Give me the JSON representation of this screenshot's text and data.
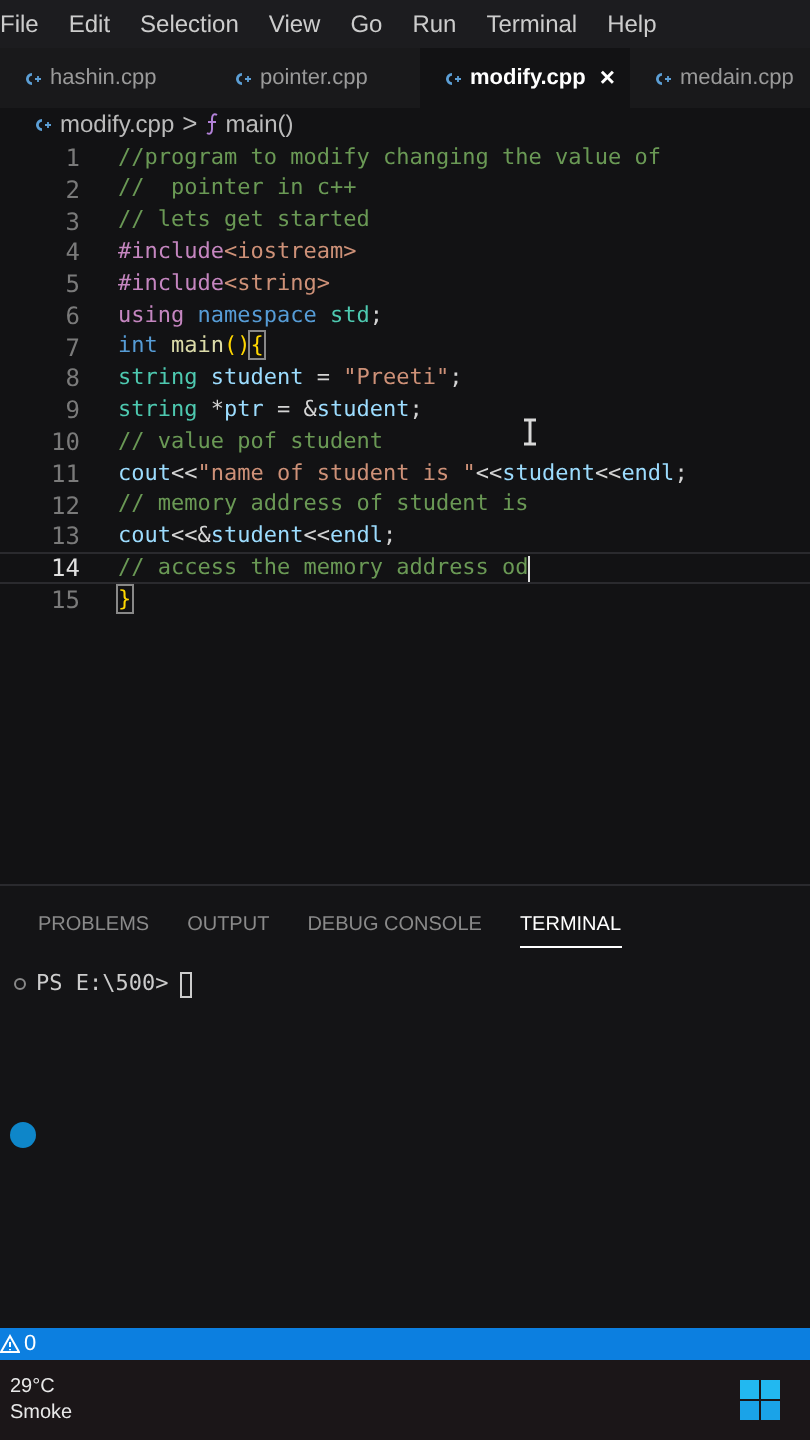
{
  "menu": [
    "File",
    "Edit",
    "Selection",
    "View",
    "Go",
    "Run",
    "Terminal",
    "Help"
  ],
  "tabs": [
    {
      "label": "hashin.cpp",
      "selected": false
    },
    {
      "label": "pointer.cpp",
      "selected": false
    },
    {
      "label": "modify.cpp",
      "selected": true,
      "close": "×"
    },
    {
      "label": "medain.cpp",
      "selected": false
    }
  ],
  "breadcrumb": {
    "file": "modify.cpp",
    "separator": ">",
    "symbol": "main()"
  },
  "code_lines": [
    {
      "number": "1",
      "current": false,
      "tokens": [
        {
          "kind": "comment",
          "text": "//program to modify changing the value of"
        }
      ]
    },
    {
      "number": "2",
      "current": false,
      "tokens": [
        {
          "kind": "comment",
          "text": "//  pointer in c++"
        }
      ]
    },
    {
      "number": "3",
      "current": false,
      "tokens": [
        {
          "kind": "comment",
          "text": "// lets get started"
        }
      ]
    },
    {
      "number": "4",
      "current": false,
      "tokens": [
        {
          "kind": "directive",
          "text": "#include"
        },
        {
          "kind": "header",
          "text": "<iostream>"
        }
      ]
    },
    {
      "number": "5",
      "current": false,
      "tokens": [
        {
          "kind": "directive",
          "text": "#include"
        },
        {
          "kind": "header",
          "text": "<string>"
        }
      ]
    },
    {
      "number": "6",
      "current": false,
      "tokens": [
        {
          "kind": "control",
          "text": "using"
        },
        {
          "kind": "storage",
          "text": " namespace"
        },
        {
          "kind": "type",
          "text": " std"
        },
        {
          "kind": "plain",
          "text": ";"
        }
      ]
    },
    {
      "number": "7",
      "current": false,
      "tokens": [
        {
          "kind": "storage",
          "text": "int"
        },
        {
          "kind": "function",
          "text": " main"
        },
        {
          "kind": "paren",
          "text": "()"
        },
        {
          "kind": "bracket_match",
          "text": "{"
        }
      ]
    },
    {
      "number": "8",
      "current": false,
      "tokens": [
        {
          "kind": "type",
          "text": "string"
        },
        {
          "kind": "variable",
          "text": " student"
        },
        {
          "kind": "plain",
          "text": " = "
        },
        {
          "kind": "string",
          "text": "\"Preeti\""
        },
        {
          "kind": "plain",
          "text": ";"
        }
      ]
    },
    {
      "number": "9",
      "current": false,
      "tokens": [
        {
          "kind": "type",
          "text": "string"
        },
        {
          "kind": "plain",
          "text": " *"
        },
        {
          "kind": "variable",
          "text": "ptr"
        },
        {
          "kind": "plain",
          "text": " = &"
        },
        {
          "kind": "variable",
          "text": "student"
        },
        {
          "kind": "plain",
          "text": ";"
        }
      ]
    },
    {
      "number": "10",
      "current": false,
      "tokens": [
        {
          "kind": "comment",
          "text": "// value pof student"
        }
      ]
    },
    {
      "number": "11",
      "current": false,
      "tokens": [
        {
          "kind": "variable",
          "text": "cout"
        },
        {
          "kind": "plain",
          "text": "<<"
        },
        {
          "kind": "string",
          "text": "\"name of student is \""
        },
        {
          "kind": "plain",
          "text": "<<"
        },
        {
          "kind": "variable",
          "text": "student"
        },
        {
          "kind": "plain",
          "text": "<<"
        },
        {
          "kind": "variable",
          "text": "endl"
        },
        {
          "kind": "plain",
          "text": ";"
        }
      ]
    },
    {
      "number": "12",
      "current": false,
      "tokens": [
        {
          "kind": "comment",
          "text": "// memory address of student is"
        }
      ]
    },
    {
      "number": "13",
      "current": false,
      "tokens": [
        {
          "kind": "variable",
          "text": "cout"
        },
        {
          "kind": "plain",
          "text": "<<&"
        },
        {
          "kind": "variable",
          "text": "student"
        },
        {
          "kind": "plain",
          "text": "<<"
        },
        {
          "kind": "variable",
          "text": "endl"
        },
        {
          "kind": "plain",
          "text": ";"
        }
      ]
    },
    {
      "number": "14",
      "current": true,
      "tokens": [
        {
          "kind": "comment",
          "text": "// access the memory address od"
        }
      ]
    },
    {
      "number": "15",
      "current": false,
      "tokens": [
        {
          "kind": "bracket_match",
          "text": "}"
        }
      ]
    }
  ],
  "panel_tabs": [
    {
      "label": "PROBLEMS",
      "selected": false
    },
    {
      "label": "OUTPUT",
      "selected": false
    },
    {
      "label": "DEBUG CONSOLE",
      "selected": false
    },
    {
      "label": "TERMINAL",
      "selected": true
    }
  ],
  "terminal": {
    "prompt": "PS E:\\500>"
  },
  "status_bar": {
    "warnings": "0"
  },
  "taskbar": {
    "temperature": "29°C",
    "weather": "Smoke"
  }
}
